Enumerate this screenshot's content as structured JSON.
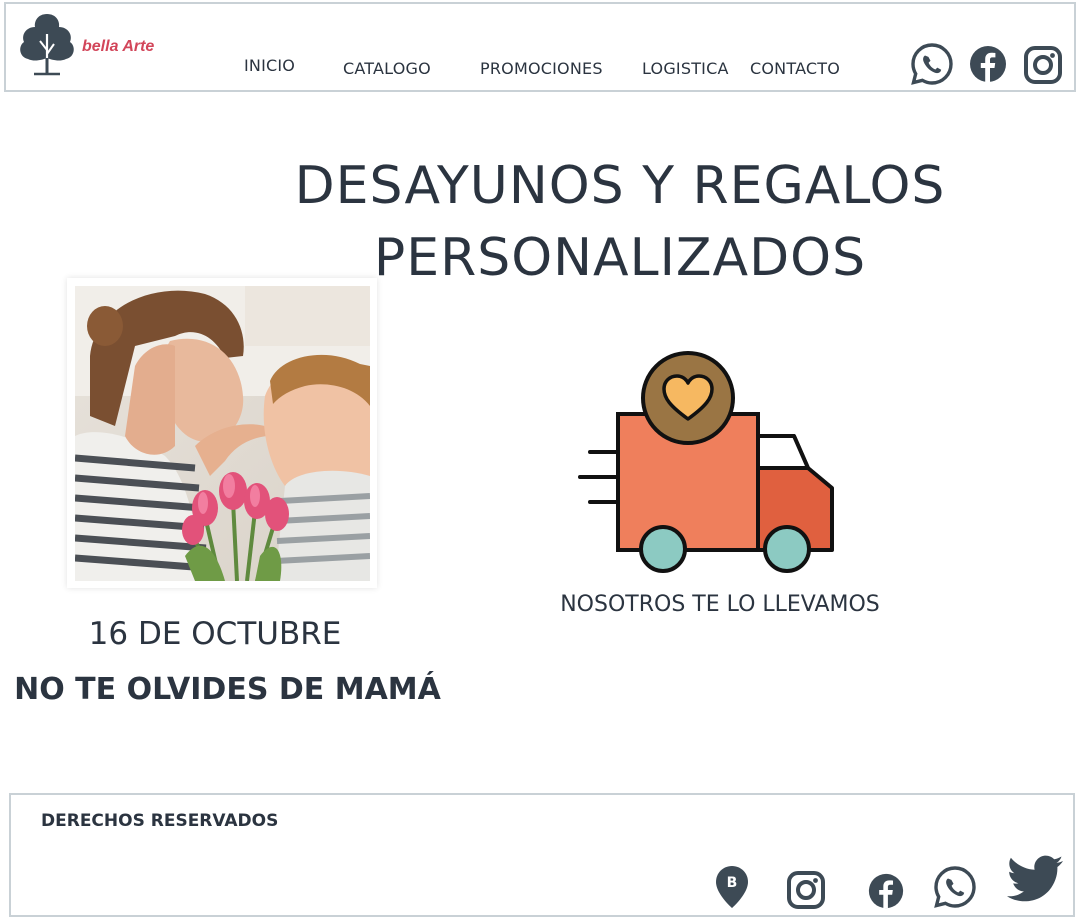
{
  "header": {
    "brand": "bella Arte",
    "nav": {
      "inicio": "INICIO",
      "catalogo": "CATALOGO",
      "promociones": "PROMOCIONES",
      "logistica": "LOGISTICA",
      "contacto": "CONTACTO"
    },
    "social_icons": [
      "whatsapp-icon",
      "facebook-icon",
      "instagram-icon"
    ]
  },
  "main": {
    "headline_line1": "DESAYUNOS Y REGALOS",
    "headline_line2": "PERSONALIZADOS",
    "date": "16 DE OCTUBRE",
    "promo": "NO TE OLVIDES DE MAMÁ",
    "delivery": "NOSOTROS TE LO LLEVAMOS"
  },
  "footer": {
    "rights": "DERECHOS RESERVADOS",
    "icons": [
      "location-pin-icon",
      "instagram-icon",
      "facebook-icon",
      "whatsapp-icon",
      "twitter-icon"
    ]
  },
  "colors": {
    "text": "#2b3440",
    "brand": "#d2465a",
    "border": "#c9d1d6",
    "truck_body": "#ef7f5c",
    "truck_cab": "#e0603f",
    "wheel": "#8ccac2",
    "badge": "#9a7544",
    "heart": "#f6b861"
  }
}
